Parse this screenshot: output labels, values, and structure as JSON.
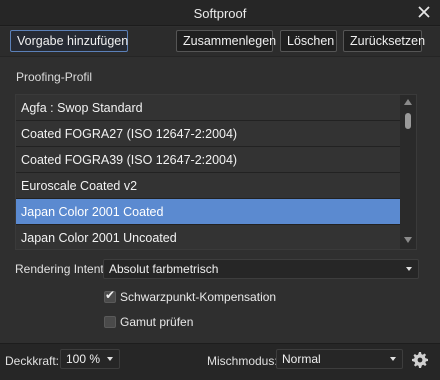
{
  "window": {
    "title": "Softproof"
  },
  "toolbar": {
    "add_preset": "Vorgabe hinzufügen",
    "merge": "Zusammenlegen",
    "delete": "Löschen",
    "reset": "Zurücksetzen"
  },
  "profile": {
    "label": "Proofing-Profil",
    "items": [
      "Agfa : Swop Standard",
      "Coated FOGRA27 (ISO 12647-2:2004)",
      "Coated FOGRA39 (ISO 12647-2:2004)",
      "Euroscale Coated v2",
      "Japan Color 2001 Coated",
      "Japan Color 2001 Uncoated"
    ],
    "selected_index": 4
  },
  "rendering_intent": {
    "label": "Rendering Intent:",
    "value": "Absolut farbmetrisch"
  },
  "options": {
    "black_point": {
      "label": "Schwarzpunkt-Kompensation",
      "checked": true,
      "mark": "✔"
    },
    "gamut": {
      "label": "Gamut prüfen",
      "checked": false
    }
  },
  "bottom": {
    "opacity_label": "Deckkraft:",
    "opacity_value": "100 %",
    "blend_label": "Mischmodus:",
    "blend_value": "Normal"
  },
  "colors": {
    "accent": "#5b8ad0",
    "panel": "#2f2f2f",
    "titlebar": "#262626"
  },
  "icons": {
    "close": "close-icon",
    "gear": "gear-icon",
    "scroll_up": "arrow-up-icon",
    "scroll_down": "arrow-down-icon"
  }
}
